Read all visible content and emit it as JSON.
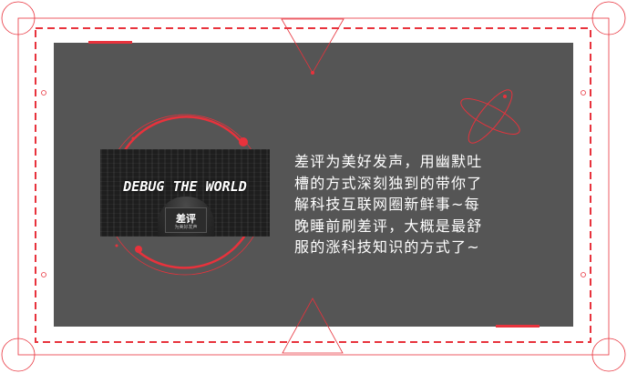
{
  "banner": {
    "title": "DEBUG THE WORLD",
    "logo_text": "差评",
    "logo_subtext": "为美好发声"
  },
  "description": {
    "lines": [
      "差评为美好发声，用幽默吐",
      "槽的方式深刻独到的带你了",
      "解科技互联网圈新鲜事~每",
      "晚睡前刷差评，大概是最舒",
      "服的涨科技知识的方式了~"
    ]
  },
  "colors": {
    "accent": "#e8323c",
    "panel": "#555555",
    "frame": "#ffffff",
    "text": "#ffffff"
  }
}
